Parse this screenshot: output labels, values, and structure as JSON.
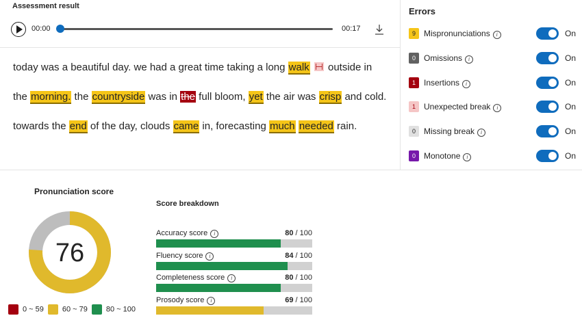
{
  "player": {
    "title": "Assessment result",
    "time_start": "00:00",
    "time_end": "00:17",
    "progress": 0
  },
  "transcript": {
    "lines": [
      [
        {
          "t": "today was a beautiful day. we had a great time taking a long ",
          "k": "plain"
        },
        {
          "t": "walk",
          "k": "mis"
        },
        {
          "t": " ",
          "k": "plain"
        },
        {
          "t": "",
          "k": "break"
        },
        {
          "t": " outside in",
          "k": "plain"
        }
      ],
      [
        {
          "t": "the ",
          "k": "plain"
        },
        {
          "t": "morning.",
          "k": "mis"
        },
        {
          "t": " the ",
          "k": "plain"
        },
        {
          "t": "countryside",
          "k": "mis"
        },
        {
          "t": " was in ",
          "k": "plain"
        },
        {
          "t": "the",
          "k": "ins"
        },
        {
          "t": " full bloom, ",
          "k": "plain"
        },
        {
          "t": "yet",
          "k": "mis"
        },
        {
          "t": " the air was ",
          "k": "plain"
        },
        {
          "t": "crisp",
          "k": "mis"
        },
        {
          "t": " and cold.",
          "k": "plain"
        }
      ],
      [
        {
          "t": "towards the ",
          "k": "plain"
        },
        {
          "t": "end",
          "k": "mis"
        },
        {
          "t": " of the day, clouds ",
          "k": "plain"
        },
        {
          "t": "came",
          "k": "mis"
        },
        {
          "t": " in, forecasting ",
          "k": "plain"
        },
        {
          "t": "much",
          "k": "mis"
        },
        {
          "t": " ",
          "k": "plain"
        },
        {
          "t": "needed",
          "k": "mis"
        },
        {
          "t": " rain.",
          "k": "plain"
        }
      ]
    ]
  },
  "errors": {
    "title": "Errors",
    "items": [
      {
        "count": "9",
        "label": "Mispronunciations",
        "badge_bg": "#f5c518",
        "badge_fg": "#242424",
        "toggle_label": "On",
        "enabled": true
      },
      {
        "count": "0",
        "label": "Omissions",
        "badge_bg": "#616161",
        "badge_fg": "#ffffff",
        "toggle_label": "On",
        "enabled": true
      },
      {
        "count": "1",
        "label": "Insertions",
        "badge_bg": "#a4000f",
        "badge_fg": "#ffffff",
        "toggle_label": "On",
        "enabled": true
      },
      {
        "count": "1",
        "label": "Unexpected break",
        "badge_bg": "#f5c6c6",
        "badge_fg": "#a4000f",
        "toggle_label": "On",
        "enabled": true
      },
      {
        "count": "0",
        "label": "Missing break",
        "badge_bg": "#e0e0e0",
        "badge_fg": "#242424",
        "toggle_label": "On",
        "enabled": true
      },
      {
        "count": "0",
        "label": "Monotone",
        "badge_bg": "#7719aa",
        "badge_fg": "#ffffff",
        "toggle_label": "On",
        "enabled": true
      }
    ]
  },
  "pronunciation": {
    "title": "Pronunciation score",
    "score": "76",
    "score_value": 76,
    "ring_color": "#e0b92c",
    "ring_bg": "#bdbdbd",
    "legend": [
      {
        "label": "0 ~ 59",
        "color": "#a4000f"
      },
      {
        "label": "60 ~ 79",
        "color": "#e0b92c"
      },
      {
        "label": "80 ~ 100",
        "color": "#1f8f4e"
      }
    ]
  },
  "breakdown": {
    "title": "Score breakdown",
    "metrics": [
      {
        "label": "Accuracy score",
        "value": "80",
        "max": "/ 100",
        "fraction": 0.8,
        "color": "#1f8f4e"
      },
      {
        "label": "Fluency score",
        "value": "84",
        "max": "/ 100",
        "fraction": 0.84,
        "color": "#1f8f4e"
      },
      {
        "label": "Completeness score",
        "value": "80",
        "max": "/ 100",
        "fraction": 0.8,
        "color": "#1f8f4e"
      },
      {
        "label": "Prosody score",
        "value": "69",
        "max": "/ 100",
        "fraction": 0.69,
        "color": "#e0b92c"
      }
    ]
  }
}
